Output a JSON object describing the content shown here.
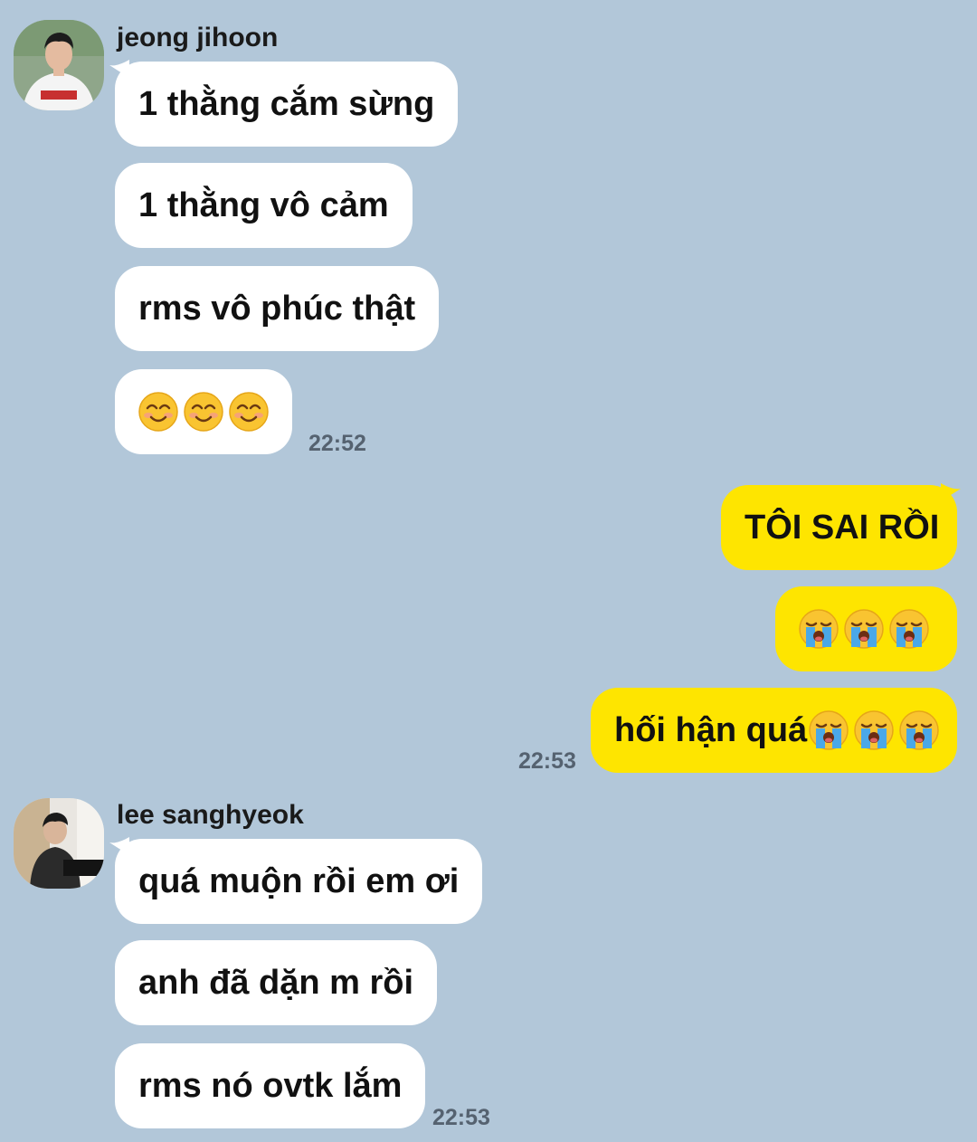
{
  "chat": {
    "group1": {
      "sender": "jeong jihoon",
      "avatar_icon": "avatar-photo-baseball-jersey",
      "messages": [
        "1 thằng cắm sừng",
        "1 thằng vô cảm",
        "rms vô phúc thật"
      ],
      "emoji_message": [
        "smiling-face-emoji",
        "smiling-face-emoji",
        "smiling-face-emoji"
      ],
      "time": "22:52"
    },
    "group2": {
      "messages": [
        "TÔI SAI RỒI"
      ],
      "emoji_message": [
        "crying-face-emoji",
        "crying-face-emoji",
        "crying-face-emoji"
      ],
      "last_message_text": "hối hận quá",
      "last_message_emoji": [
        "crying-face-emoji",
        "crying-face-emoji",
        "crying-face-emoji"
      ],
      "time": "22:53"
    },
    "group3": {
      "sender": "lee sanghyeok",
      "avatar_icon": "avatar-photo-piano",
      "messages": [
        "quá muộn rồi em ơi",
        "anh đã dặn m rồi",
        "rms nó ovtk lắm"
      ],
      "time": "22:53"
    }
  },
  "colors": {
    "background": "#b2c7d9",
    "incoming_bubble": "#ffffff",
    "outgoing_bubble": "#fee500",
    "time_text": "#556270"
  }
}
